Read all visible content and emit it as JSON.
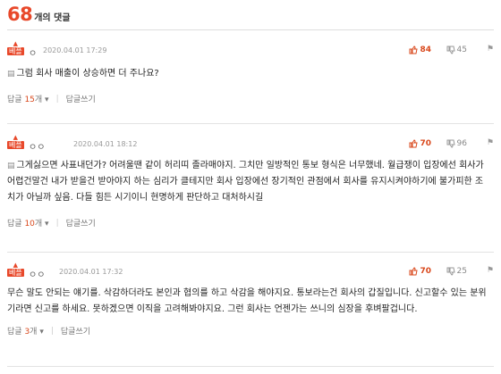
{
  "header": {
    "count": "68",
    "label": "개의 댓글"
  },
  "comments": [
    {
      "badge": "베플",
      "nickname": "ㅇ",
      "date": "2020.04.01 17:29",
      "likes": "84",
      "dislikes": "45",
      "text": "그럼 회사 매출이 상승하면 더 주나요?",
      "reply_prefix": "답글",
      "reply_count": "15",
      "reply_suffix": "개",
      "write_reply": "답글쓰기"
    },
    {
      "badge": "베플",
      "nickname": "ㅇㅇ",
      "date": "2020.04.01 18:12",
      "likes": "70",
      "dislikes": "96",
      "text": "그게싫으면 사표내던가? 어려울땐 같이 허리띠 졸라매야지. 그치만 일방적인 통보 형식은 너무했네. 월급쟁이 입장에선 회사가 어렵건말건 내가 받을건 받아야지 하는 심리가 클테지만 회사 입장에선 장기적인 관점에서 회사를 유지시켜야하기에 불가피한 조치가 아닐까 싶음. 다들 힘든 시기이니 현명하게 판단하고 대처하시길",
      "reply_prefix": "답글",
      "reply_count": "10",
      "reply_suffix": "개",
      "write_reply": "답글쓰기"
    },
    {
      "badge": "베플",
      "nickname": "ㅇㅇ",
      "date": "2020.04.01 17:32",
      "likes": "70",
      "dislikes": "25",
      "text": "무슨 말도 안되는 얘기를. 삭감하더라도 본인과 협의를 하고 삭감을 해야지요. 통보라는건 회사의 갑질입니다. 신고할수 있는 분위기라면 신고를 하세요. 못하겠으면 이직을 고려해봐야지요. 그런 회사는 언젠가는 쓰니의 심장을 후벼팔겁니다.",
      "reply_prefix": "답글",
      "reply_count": "3",
      "reply_suffix": "개",
      "write_reply": "답글쓰기"
    }
  ]
}
